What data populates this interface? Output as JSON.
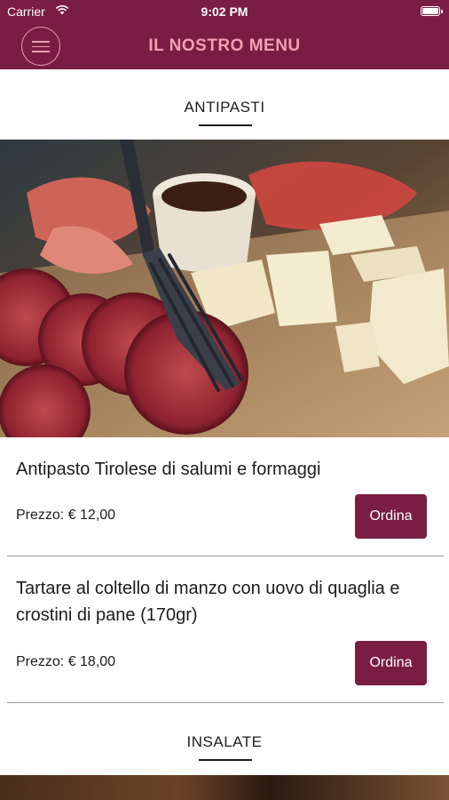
{
  "status_bar": {
    "carrier": "Carrier",
    "time": "9:02 PM"
  },
  "header": {
    "title": "IL NOSTRO MENU"
  },
  "sections": [
    {
      "title": "ANTIPASTI",
      "items": [
        {
          "name": "Antipasto Tirolese di salumi e formaggi",
          "price": "Prezzo: € 12,00",
          "order_label": "Ordina"
        },
        {
          "name": "Tartare al coltello di manzo con uovo di quaglia e crostini di pane (170gr)",
          "price": "Prezzo: € 18,00",
          "order_label": "Ordina"
        }
      ]
    },
    {
      "title": "INSALATE"
    }
  ],
  "colors": {
    "brand": "#7a1d42",
    "header_text": "#f0a0b4"
  }
}
